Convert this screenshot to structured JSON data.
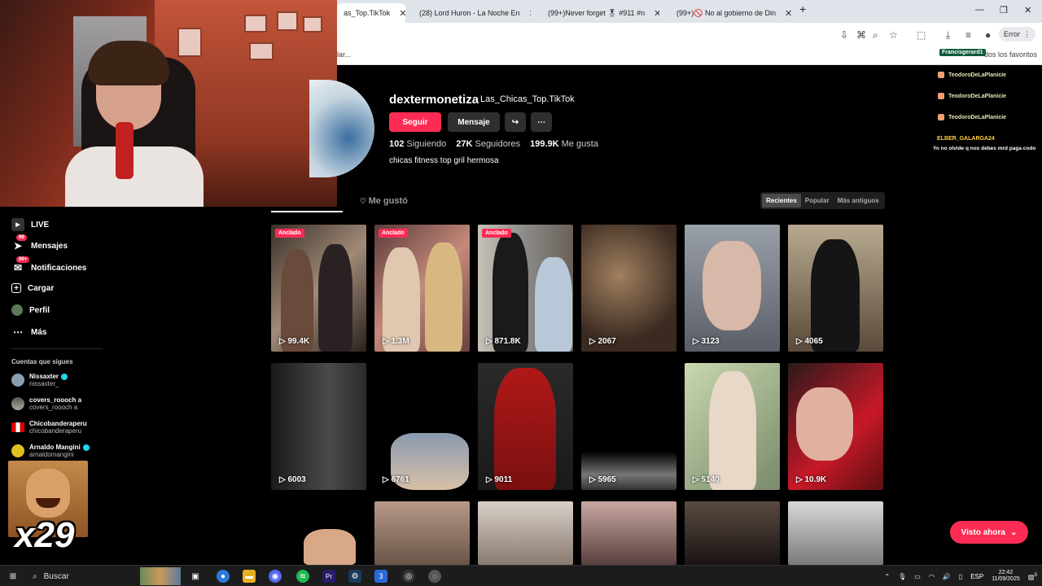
{
  "browser": {
    "tabs": [
      {
        "label": "as_Top.TikTok",
        "active": true
      },
      {
        "label": "(28) Lord Huron - La Noche En"
      },
      {
        "label": "(99+)Never forget 🎖 #911 #n"
      },
      {
        "label": "(99+)🚫 No al gobierno de Din"
      }
    ],
    "new_tab": "+",
    "error_label": "Error",
    "bookmark_left": "lar...",
    "bookmark_right": "dos los favoritos"
  },
  "sidebar": {
    "items": [
      {
        "label": "LIVE",
        "icon": "live-icon"
      },
      {
        "label": "Mensajes",
        "icon": "messages-icon",
        "badge": "99"
      },
      {
        "label": "Notificaciones",
        "icon": "notifications-icon",
        "badge": "99+"
      },
      {
        "label": "Cargar",
        "icon": "upload-icon"
      },
      {
        "label": "Perfil",
        "icon": "profile-icon"
      },
      {
        "label": "Más",
        "icon": "more-icon"
      }
    ],
    "following_title": "Cuentas que sigues",
    "following": [
      {
        "name": "Nissaxter",
        "handle": "nissaxter_",
        "verified": true
      },
      {
        "name": "covers_roooch a",
        "handle": "covers_roooch a",
        "verified": false
      },
      {
        "name": "Chicobanderaperu",
        "handle": "chicobanderaperu",
        "verified": false
      },
      {
        "name": "Arnaldo Mangini",
        "handle": "arnaldomangini",
        "verified": true
      }
    ]
  },
  "overlay": {
    "emote_text": "x29"
  },
  "profile": {
    "username": "dextermonetiza",
    "nickname": "Las_Chicas_Top.TikTok",
    "follow_label": "Seguir",
    "message_label": "Mensaje",
    "stats": [
      {
        "value": "102",
        "label": "Siguiendo"
      },
      {
        "value": "27K",
        "label": "Seguidores"
      },
      {
        "value": "199.9K",
        "label": "Me gusta"
      }
    ],
    "bio": "chicas fitness top gril hermosa",
    "liked_tab": "Me gustó",
    "sort_options": [
      "Recientes",
      "Popular",
      "Más antiguos"
    ]
  },
  "videos": [
    {
      "views": "99.4K",
      "pinned": "Anclado"
    },
    {
      "views": "1.3M",
      "pinned": "Anclado"
    },
    {
      "views": "871.8K",
      "pinned": "Anclado"
    },
    {
      "views": "2067"
    },
    {
      "views": "3123"
    },
    {
      "views": "4065"
    },
    {
      "views": "6003"
    },
    {
      "views": "6761"
    },
    {
      "views": "9011"
    },
    {
      "views": "5965"
    },
    {
      "views": "5140"
    },
    {
      "views": "10.9K"
    }
  ],
  "visto_ahora": "Visto ahora",
  "chat": [
    {
      "name": "Francisgerard1"
    },
    {
      "name": "TeodoroDeLaPlanicie"
    },
    {
      "name": "TeodoroDeLaPlanicie"
    },
    {
      "name": "TeodoroDeLaPlanicie"
    },
    {
      "name": "ELBER_GALARGA24",
      "message": "Yo no olvide q nos debes mrd paga codo"
    }
  ],
  "taskbar": {
    "search_label": "Buscar",
    "lang": "ESP",
    "time": "22:42",
    "date": "11/09/2025",
    "notif_count": "3"
  },
  "colors": {
    "accent": "#fe2c55",
    "verified": "#20d5ec"
  }
}
